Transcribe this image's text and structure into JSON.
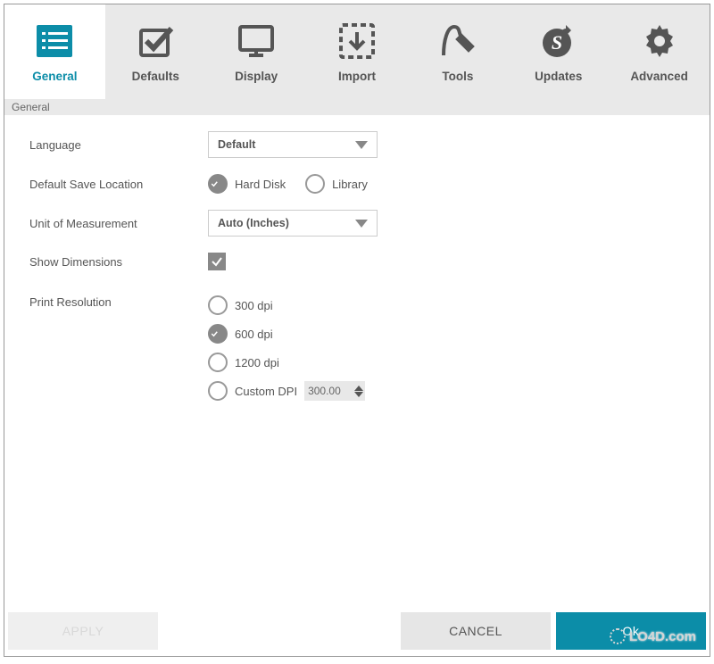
{
  "tabs": [
    {
      "label": "General"
    },
    {
      "label": "Defaults"
    },
    {
      "label": "Display"
    },
    {
      "label": "Import"
    },
    {
      "label": "Tools"
    },
    {
      "label": "Updates"
    },
    {
      "label": "Advanced"
    }
  ],
  "section_title": "General",
  "labels": {
    "language": "Language",
    "default_save_location": "Default Save Location",
    "unit_of_measurement": "Unit of Measurement",
    "show_dimensions": "Show Dimensions",
    "print_resolution": "Print Resolution"
  },
  "language": {
    "selected": "Default"
  },
  "save_location": {
    "hard_disk": "Hard Disk",
    "library": "Library",
    "selected": "hard_disk"
  },
  "unit": {
    "selected": "Auto (Inches)"
  },
  "show_dimensions_checked": true,
  "print_resolution": {
    "options": {
      "dpi300": "300 dpi",
      "dpi600": "600 dpi",
      "dpi1200": "1200 dpi",
      "custom": "Custom DPI"
    },
    "selected": "dpi600",
    "custom_value": "300.00"
  },
  "buttons": {
    "apply": "APPLY",
    "cancel": "CANCEL",
    "ok": "Ok"
  },
  "watermark": "LO4D.com"
}
